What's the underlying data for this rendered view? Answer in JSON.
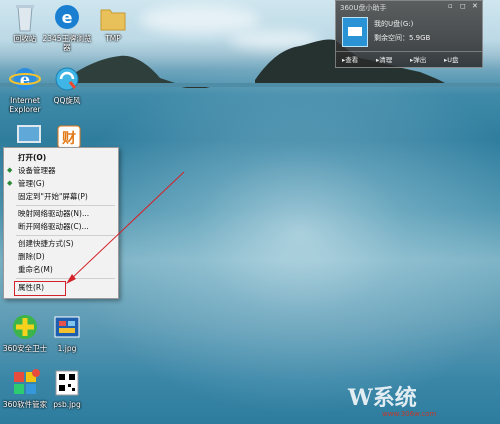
{
  "desktop_icons": [
    {
      "label": "回收站",
      "icon": "recycle-bin-icon"
    },
    {
      "label": "2345王牌浏览器",
      "icon": "browser-2345-icon"
    },
    {
      "label": "TMP",
      "icon": "folder-icon"
    },
    {
      "label": "Internet Explorer",
      "icon": "internet-explorer-icon"
    },
    {
      "label": "QQ旋风",
      "icon": "qq-whirlwind-icon"
    },
    {
      "label": "360安全卫士",
      "icon": "360-safe-icon"
    },
    {
      "label": "1.jpg",
      "icon": "image-file-icon"
    },
    {
      "label": "360软件管家",
      "icon": "360-software-icon"
    },
    {
      "label": "psb.jpg",
      "icon": "qr-image-file-icon"
    }
  ],
  "context_menu": {
    "items": [
      "打开(O)",
      "设备管理器",
      "管理(G)",
      "固定到\"开始\"屏幕(P)",
      "映射网络驱动器(N)...",
      "断开网络驱动器(C)...",
      "创建快捷方式(S)",
      "删除(D)",
      "重命名(M)",
      "属性(R)"
    ]
  },
  "panel": {
    "title": "360U盘小助手",
    "drive_name": "我的U盘(G:)",
    "free_space": "剩余空间：5.9GB",
    "buttons": [
      "查看",
      "清理",
      "弹出",
      "U盘"
    ],
    "accent": "#2a93d5"
  },
  "watermark": {
    "brand": "W系统",
    "url": "www.306w.com"
  },
  "colors": {
    "highlight_box": "#d2232a",
    "arrow": "#d2232a"
  }
}
